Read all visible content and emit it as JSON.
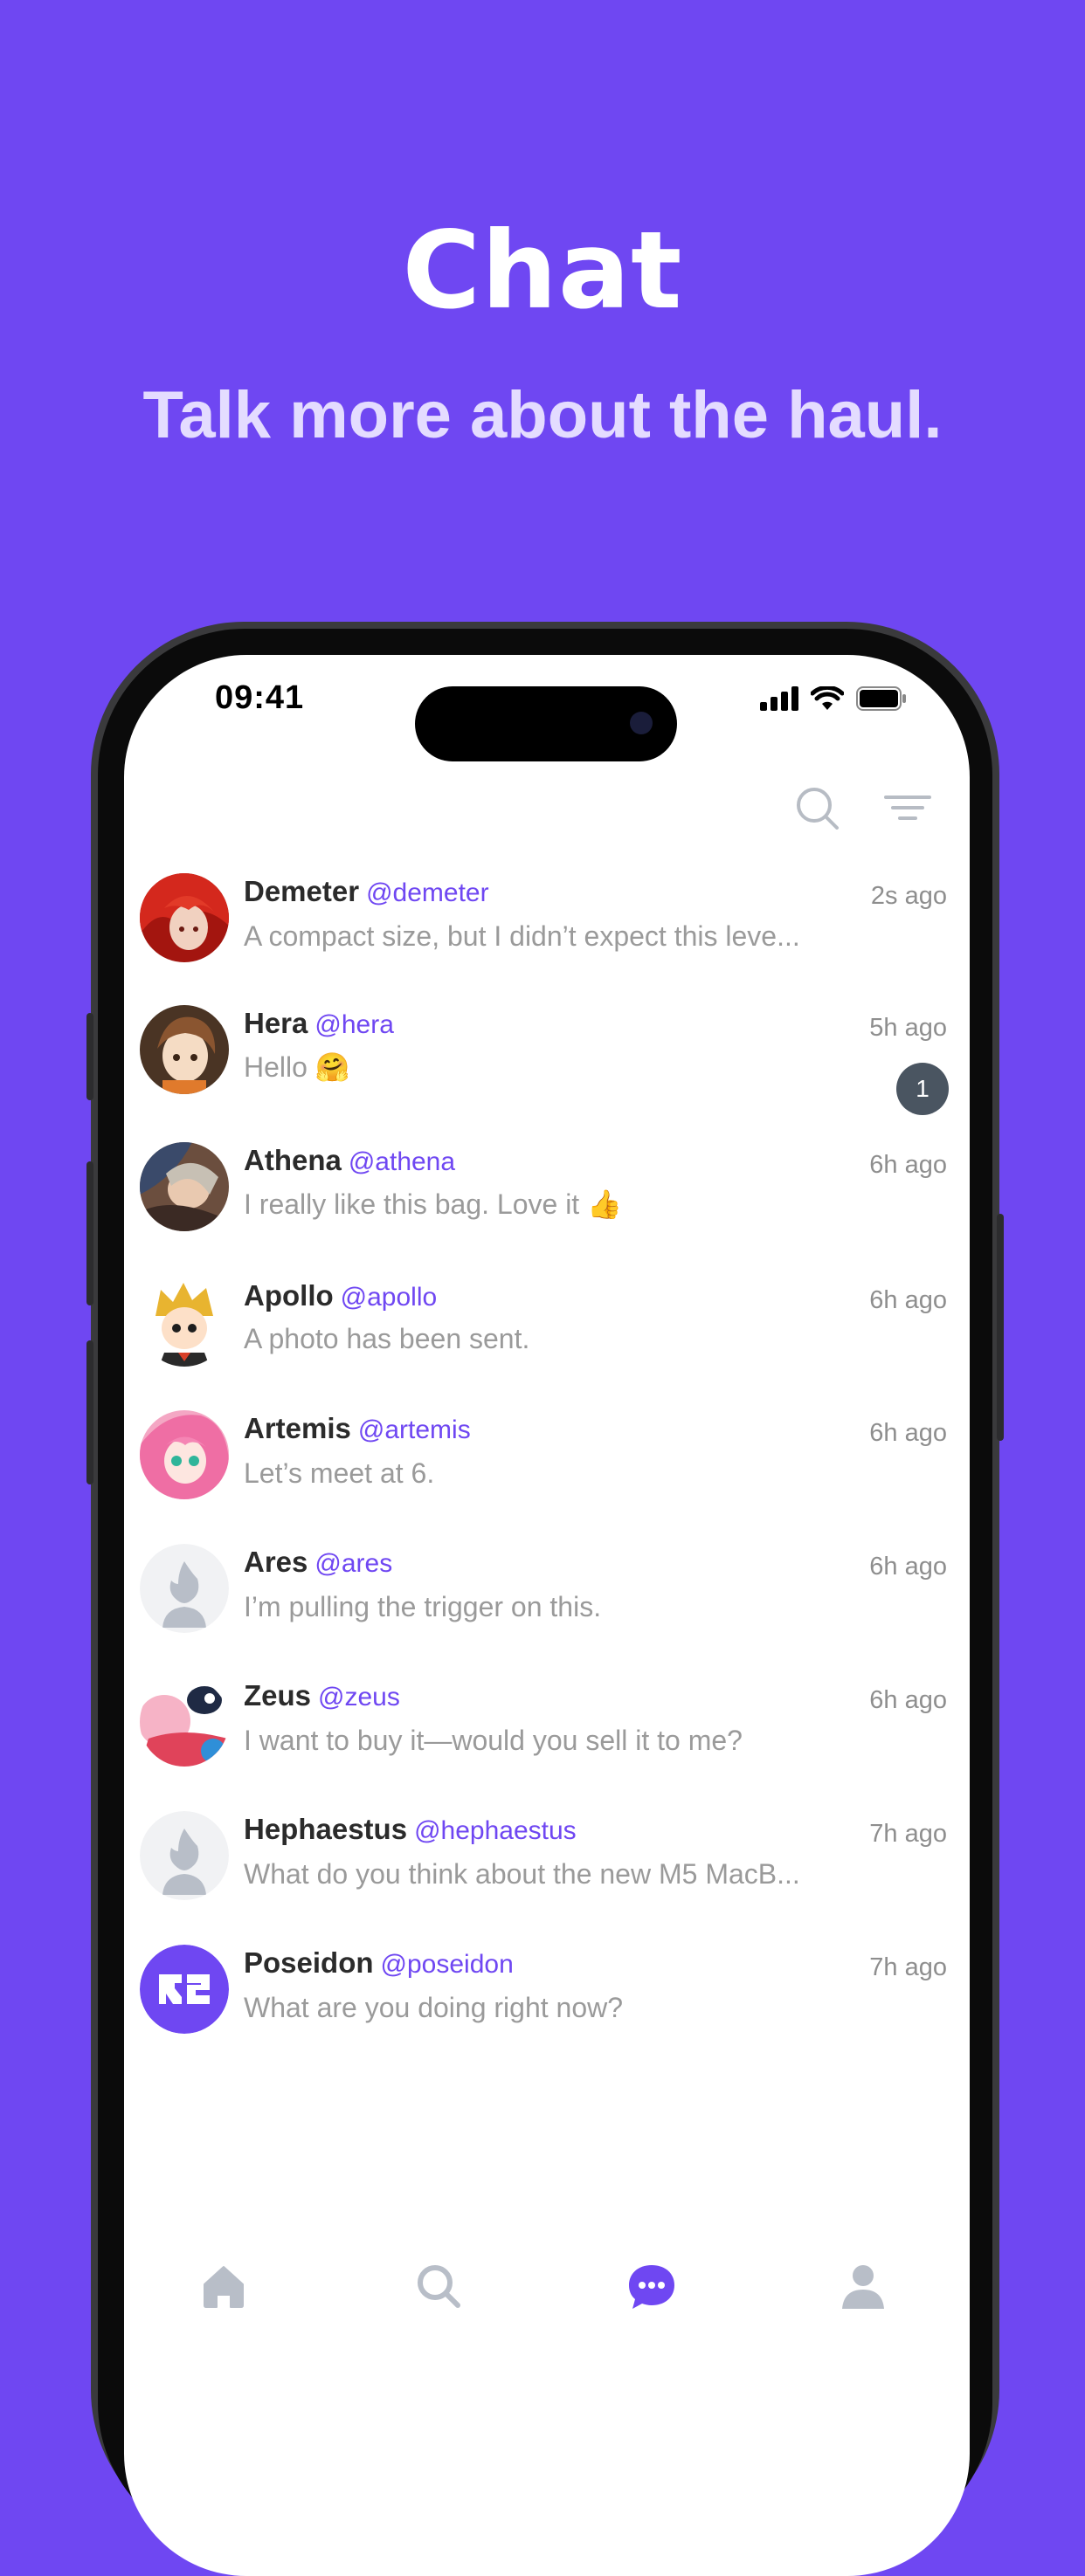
{
  "hero": {
    "title": "Chat",
    "subtitle": "Talk more about the haul."
  },
  "status_bar": {
    "time": "09:41",
    "icons": [
      "signal-icon",
      "wifi-icon",
      "battery-icon"
    ]
  },
  "top_actions": [
    "search-icon",
    "filter-icon"
  ],
  "chats": [
    {
      "name": "Demeter",
      "handle": "@demeter",
      "message": "A compact size, but I didn’t expect this leve...",
      "time": "2s ago",
      "avatar": "red-hair-avatar"
    },
    {
      "name": "Hera",
      "handle": "@hera",
      "message": "Hello 🤗",
      "time": "5h ago",
      "unread": "1",
      "avatar": "brown-hair-avatar"
    },
    {
      "name": "Athena",
      "handle": "@athena",
      "message": "I really like this bag.  Love it 👍",
      "time": "6h ago",
      "avatar": "artwork-avatar"
    },
    {
      "name": "Apollo",
      "handle": "@apollo",
      "message": "A photo has been sent.",
      "time": "6h ago",
      "avatar": "blonde-cartoon-avatar"
    },
    {
      "name": "Artemis",
      "handle": "@artemis",
      "message": "Let’s meet at 6.",
      "time": "6h ago",
      "avatar": "pink-hair-avatar"
    },
    {
      "name": "Ares",
      "handle": "@ares",
      "message": "I’m pulling the trigger on this.",
      "time": "6h ago",
      "avatar": "default-user-avatar"
    },
    {
      "name": "Zeus",
      "handle": "@zeus",
      "message": "I want to buy it—would you sell it to me?",
      "time": "6h ago",
      "avatar": "pink-character-avatar"
    },
    {
      "name": "Hephaestus",
      "handle": "@hephaestus",
      "message": "What do you think about the new M5 MacB...",
      "time": "7h ago",
      "avatar": "default-user-avatar"
    },
    {
      "name": "Poseidon",
      "handle": "@poseidon",
      "message": "What are you doing right now?",
      "time": "7h ago",
      "avatar": "purple-logo-avatar"
    }
  ],
  "tabs": [
    {
      "icon": "home-icon",
      "active": false
    },
    {
      "icon": "search-icon",
      "active": false
    },
    {
      "icon": "chat-icon",
      "active": true
    },
    {
      "icon": "profile-icon",
      "active": false
    }
  ],
  "colors": {
    "brand": "#6F47F2",
    "subtitle": "#E4DCFF",
    "handle": "#6F47F2",
    "muted": "#9a9a9a",
    "badge": "#4a5561",
    "tab_inactive": "#b8bec8"
  }
}
